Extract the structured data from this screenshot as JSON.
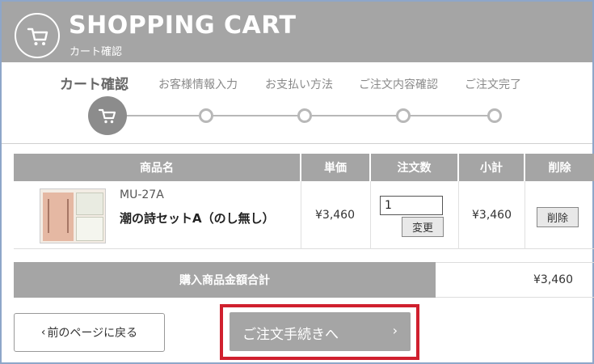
{
  "header": {
    "title": "SHOPPING CART",
    "subtitle": "カート確認",
    "icon": "shopping-cart-icon"
  },
  "steps": [
    {
      "label": "カート確認",
      "active": true
    },
    {
      "label": "お客様情報入力",
      "active": false
    },
    {
      "label": "お支払い方法",
      "active": false
    },
    {
      "label": "ご注文内容確認",
      "active": false
    },
    {
      "label": "ご注文完了",
      "active": false
    }
  ],
  "table": {
    "columns": [
      "商品名",
      "単価",
      "注文数",
      "小計",
      "削除"
    ],
    "rows": [
      {
        "code": "MU-27A",
        "name": "潮の詩セットA（のし無し）",
        "unit_price": "¥3,460",
        "quantity": "1",
        "update_label": "変更",
        "subtotal": "¥3,460",
        "delete_label": "削除"
      }
    ]
  },
  "total": {
    "label": "購入商品金額合計",
    "value": "¥3,460"
  },
  "buttons": {
    "back": "前のページに戻る",
    "back_chevron": "‹",
    "proceed": "ご注文手続きへ",
    "proceed_chevron": "›"
  },
  "colors": {
    "header_gray": "#a5a5a5",
    "highlight_red": "#d0202e"
  }
}
